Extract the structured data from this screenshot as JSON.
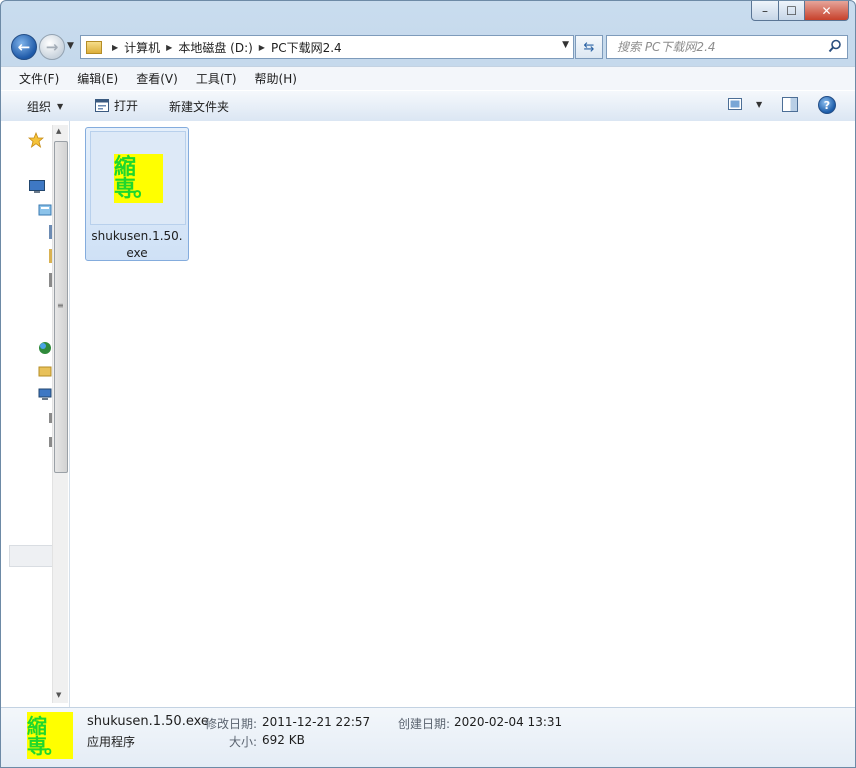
{
  "window": {
    "controls": {
      "minimize": "–",
      "maximize": "☐",
      "close": "✕"
    }
  },
  "address_bar": {
    "breadcrumbs": [
      "计算机",
      "本地磁盘 (D:)",
      "PC下载网2.4"
    ]
  },
  "search": {
    "placeholder": "搜索 PC下载网2.4"
  },
  "menu": [
    "文件(F)",
    "编辑(E)",
    "查看(V)",
    "工具(T)",
    "帮助(H)"
  ],
  "toolbar": {
    "organize": "组织",
    "open": "打开",
    "new_folder": "新建文件夹"
  },
  "files": [
    {
      "name": "shukusen.1.50.exe",
      "thumb_text": "縮専。",
      "selected": true
    }
  ],
  "details": {
    "name": "shukusen.1.50.exe",
    "type": "应用程序",
    "modified_label": "修改日期:",
    "modified_value": "2011-12-21 22:57",
    "created_label": "创建日期:",
    "created_value": "2020-02-04 13:31",
    "size_label": "大小:",
    "size_value": "692 KB",
    "thumb_text": "縮専。"
  },
  "colors": {
    "thumb_bg": "#ffff00",
    "thumb_text": "#1fd72c",
    "selection": "#cfe1f6"
  }
}
